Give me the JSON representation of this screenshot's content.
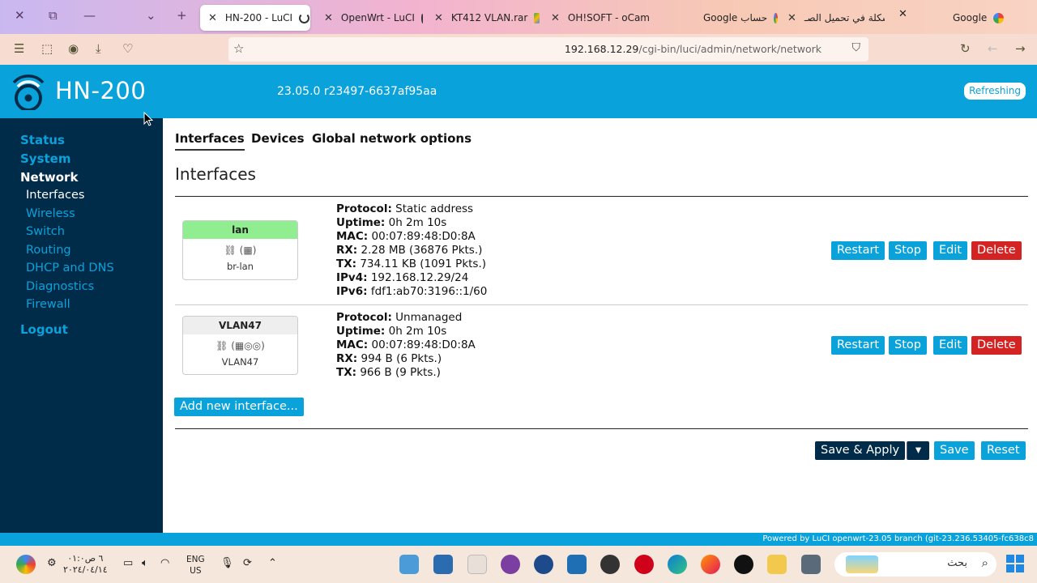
{
  "browser": {
    "tabs": [
      {
        "title": "HN-200 - LuCI"
      },
      {
        "title": "OpenWrt - LuCI"
      },
      {
        "title": "KT412 VLAN.rar"
      },
      {
        "title": "OH!SOFT - oCam"
      },
      {
        "title": "Google حساب"
      },
      {
        "title": "مشكلة في تحميل الصـ"
      },
      {
        "title": "Google"
      }
    ],
    "url_host": "192.168.12.29",
    "url_path": "/cgi-bin/luci/admin/network/network"
  },
  "header": {
    "brand": "HN-200",
    "version": "23.05.0 r23497-6637af95aa",
    "status_badge": "Refreshing"
  },
  "sidebar": {
    "status": "Status",
    "system": "System",
    "network": "Network",
    "sub": [
      "Interfaces",
      "Wireless",
      "Switch",
      "Routing",
      "DHCP and DNS",
      "Diagnostics",
      "Firewall"
    ],
    "logout": "Logout"
  },
  "main": {
    "tabs": [
      "Interfaces",
      "Devices",
      "Global network options"
    ],
    "heading": "Interfaces",
    "interfaces": [
      {
        "name": "lan",
        "device": "br-lan",
        "head_color": "#90ee90",
        "protocol": "Static address",
        "uptime": "0h 2m 10s",
        "mac": "00:07:89:48:D0:8A",
        "rx": "2.28 MB (36876 Pkts.)",
        "tx": "734.11 KB (1091 Pkts.)",
        "ipv4": "192.168.12.29/24",
        "ipv6": "fdf1:ab70:3196::1/60"
      },
      {
        "name": "VLAN47",
        "device": "VLAN47",
        "head_color": "#eeeeee",
        "protocol": "Unmanaged",
        "uptime": "0h 2m 10s",
        "mac": "00:07:89:48:D0:8A",
        "rx": "994 B (6 Pkts.)",
        "tx": "966 B (9 Pkts.)"
      }
    ],
    "labels": {
      "protocol": "Protocol:",
      "uptime": "Uptime:",
      "mac": "MAC:",
      "rx": "RX:",
      "tx": "TX:",
      "ipv4": "IPv4:",
      "ipv6": "IPv6:"
    },
    "buttons": {
      "restart": "Restart",
      "stop": "Stop",
      "edit": "Edit",
      "delete": "Delete",
      "add": "Add new interface...",
      "save_apply": "Save & Apply",
      "dropdown": "▾",
      "save": "Save",
      "reset": "Reset"
    }
  },
  "footer": {
    "text": "Powered by LuCI openwrt-23.05 branch (git-23.236.53405-fc638c8"
  },
  "taskbar": {
    "lang_top": "ENG",
    "lang_bottom": "US",
    "time": "۰۱:۰٦ ص",
    "date": "٢٠٢٤/٠٤/١٤",
    "search_placeholder": "بحث"
  }
}
